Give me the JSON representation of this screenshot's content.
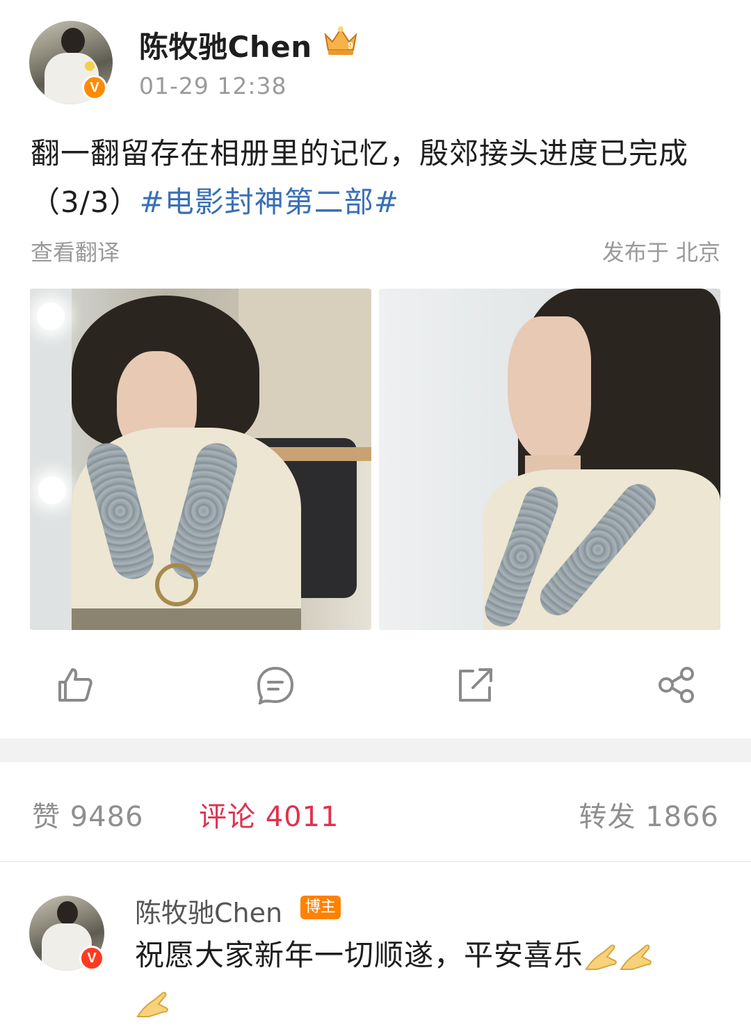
{
  "post": {
    "author": {
      "name": "陈牧驰Chen",
      "verified_mark": "V",
      "badge_icon": "crown-rank-icon"
    },
    "timestamp": "01-29 12:38",
    "text_before_tag": "翻一翻留存在相册里的记忆，殷郊接头进度已完成（3/3）",
    "hashtag": "#电影封神第二部#",
    "translate_label": "查看翻译",
    "location": "发布于 北京",
    "photos": [
      {
        "description_icon": "photo-mirror-selfie"
      },
      {
        "description_icon": "photo-side-profile"
      }
    ],
    "actions": [
      {
        "icon": "thumbs-up-icon"
      },
      {
        "icon": "comment-icon"
      },
      {
        "icon": "repost-icon"
      },
      {
        "icon": "share-icon"
      }
    ]
  },
  "stats": {
    "likes_label": "赞 9486",
    "comments_label": "评论 4011",
    "reposts_label": "转发 1866",
    "active_color": "#e0314f"
  },
  "comment": {
    "author": "陈牧驰Chen",
    "author_badge": "博主",
    "verified_mark": "V",
    "text": "祝愿大家新年一切顺遂，平安喜乐",
    "emoji": "folded-hands-icon"
  },
  "colors": {
    "hashtag": "#3a6fb5",
    "verified": "#ff8a00",
    "host_badge": "#ff8200"
  }
}
